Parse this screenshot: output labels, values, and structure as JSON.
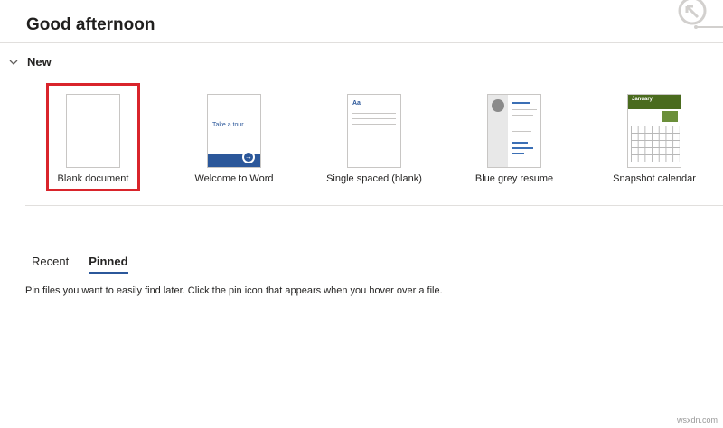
{
  "greeting": "Good afternoon",
  "new_section": {
    "label": "New",
    "expanded": true
  },
  "templates": [
    {
      "label": "Blank document",
      "selected": true
    },
    {
      "label": "Welcome to Word",
      "thumb_text": "Take a tour"
    },
    {
      "label": "Single spaced (blank)",
      "thumb_text": "Aa"
    },
    {
      "label": "Blue grey resume"
    },
    {
      "label": "Snapshot calendar",
      "thumb_text": "January"
    }
  ],
  "tabs": [
    {
      "label": "Recent",
      "active": false
    },
    {
      "label": "Pinned",
      "active": true
    }
  ],
  "pinned_hint": "Pin files you want to easily find later. Click the pin icon that appears when you hover over a file.",
  "watermark": "wsxdn.com",
  "colors": {
    "accent": "#2b579a",
    "selection": "#d9242b",
    "calendar_green": "#4a6b1e"
  }
}
